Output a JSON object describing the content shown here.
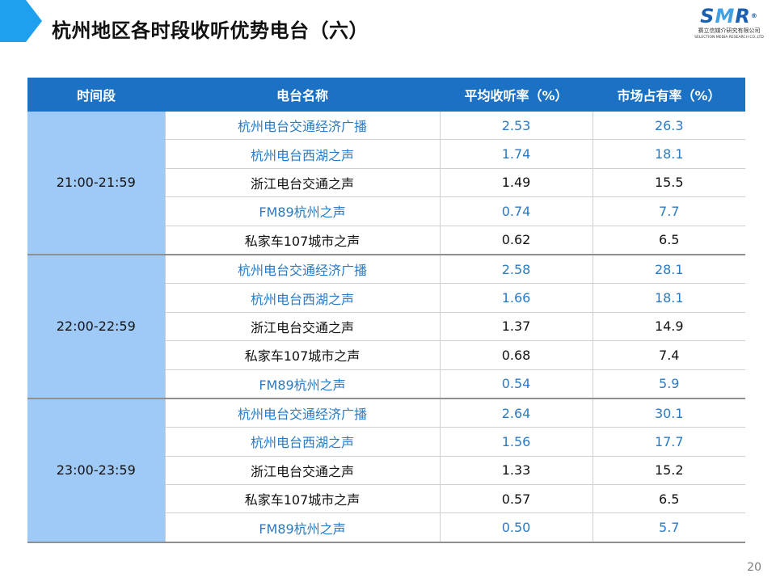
{
  "title": "杭州地区各时段收听优势电台（六）",
  "logo": {
    "mark_left": "S",
    "mark_mid": "M",
    "mark_right": "R",
    "reg": "®",
    "company_cn": "赛立信媒介研究有限公司",
    "company_en": "SELECTION MEDIA RESEARCH CO.,LTD"
  },
  "colors": {
    "header_bg": "#1b72c4",
    "period_bg": "#9fcaf7",
    "highlight_text": "#2a7ac4"
  },
  "table": {
    "headers": [
      "时间段",
      "电台名称",
      "平均收听率（%）",
      "市场占有率（%）"
    ],
    "groups": [
      {
        "period": "21:00-21:59",
        "rows": [
          {
            "station": "杭州电台交通经济广播",
            "rating": "2.53",
            "share": "26.3",
            "highlight": true
          },
          {
            "station": "杭州电台西湖之声",
            "rating": "1.74",
            "share": "18.1",
            "highlight": true
          },
          {
            "station": "浙江电台交通之声",
            "rating": "1.49",
            "share": "15.5",
            "highlight": false
          },
          {
            "station": "FM89杭州之声",
            "rating": "0.74",
            "share": "7.7",
            "highlight": true
          },
          {
            "station": "私家车107城市之声",
            "rating": "0.62",
            "share": "6.5",
            "highlight": false
          }
        ]
      },
      {
        "period": "22:00-22:59",
        "rows": [
          {
            "station": "杭州电台交通经济广播",
            "rating": "2.58",
            "share": "28.1",
            "highlight": true
          },
          {
            "station": "杭州电台西湖之声",
            "rating": "1.66",
            "share": "18.1",
            "highlight": true
          },
          {
            "station": "浙江电台交通之声",
            "rating": "1.37",
            "share": "14.9",
            "highlight": false
          },
          {
            "station": "私家车107城市之声",
            "rating": "0.68",
            "share": "7.4",
            "highlight": false
          },
          {
            "station": "FM89杭州之声",
            "rating": "0.54",
            "share": "5.9",
            "highlight": true
          }
        ]
      },
      {
        "period": "23:00-23:59",
        "rows": [
          {
            "station": "杭州电台交通经济广播",
            "rating": "2.64",
            "share": "30.1",
            "highlight": true
          },
          {
            "station": "杭州电台西湖之声",
            "rating": "1.56",
            "share": "17.7",
            "highlight": true
          },
          {
            "station": "浙江电台交通之声",
            "rating": "1.33",
            "share": "15.2",
            "highlight": false
          },
          {
            "station": "私家车107城市之声",
            "rating": "0.57",
            "share": "6.5",
            "highlight": false
          },
          {
            "station": "FM89杭州之声",
            "rating": "0.50",
            "share": "5.7",
            "highlight": true
          }
        ]
      }
    ]
  },
  "page_number": "20"
}
